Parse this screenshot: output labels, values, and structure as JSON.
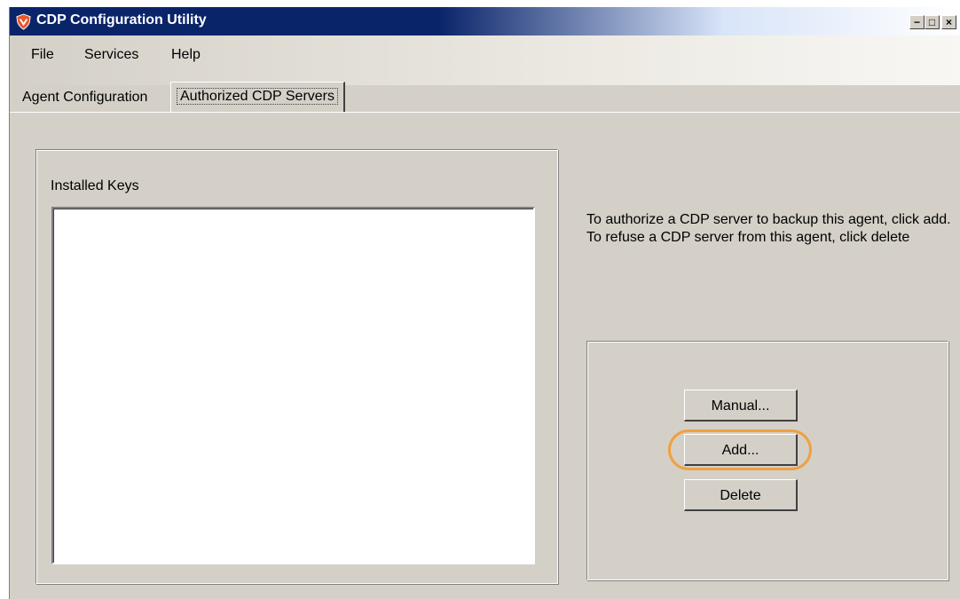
{
  "window": {
    "title": "CDP Configuration Utility",
    "controls": [
      "minimize-icon",
      "maximize-icon",
      "close-icon"
    ],
    "title_color": "#0a246a"
  },
  "menu": {
    "items": [
      "File",
      "Services",
      "Help"
    ]
  },
  "tabs": [
    {
      "label": "Agent Configuration",
      "selected": false
    },
    {
      "label": "Authorized CDP Servers",
      "selected": true
    }
  ],
  "keys_panel": {
    "label": "Installed Keys",
    "items": []
  },
  "info": {
    "text": "To authorize a CDP server to backup this agent, click add. To refuse a CDP server from this agent, click delete"
  },
  "buttons": {
    "manual": "Manual...",
    "add": "Add...",
    "delete": "Delete"
  },
  "highlight_color": "#f0a040"
}
